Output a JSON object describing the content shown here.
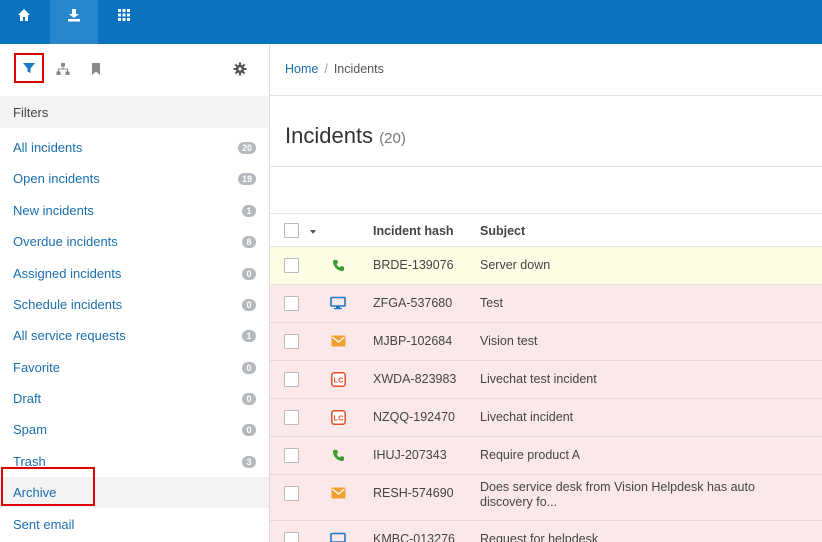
{
  "topbar": {
    "buttons": [
      {
        "name": "home",
        "icon": "home-icon"
      },
      {
        "name": "download",
        "icon": "download-icon",
        "active": true
      },
      {
        "name": "apps",
        "icon": "grid-icon"
      }
    ]
  },
  "sidebar": {
    "tools": [
      "filter-icon",
      "hierarchy-icon",
      "bookmark-icon",
      "gear-icon"
    ],
    "filters_heading": "Filters",
    "items": [
      {
        "label": "All incidents",
        "count": "20"
      },
      {
        "label": "Open incidents",
        "count": "19"
      },
      {
        "label": "New incidents",
        "count": "1"
      },
      {
        "label": "Overdue incidents",
        "count": "8"
      },
      {
        "label": "Assigned incidents",
        "count": "0"
      },
      {
        "label": "Schedule incidents",
        "count": "0"
      },
      {
        "label": "All service requests",
        "count": "1"
      },
      {
        "label": "Favorite",
        "count": "0"
      },
      {
        "label": "Draft",
        "count": "0"
      },
      {
        "label": "Spam",
        "count": "0"
      },
      {
        "label": "Trash",
        "count": "3"
      },
      {
        "label": "Archive",
        "count": ""
      },
      {
        "label": "Sent email",
        "count": ""
      }
    ]
  },
  "breadcrumb": {
    "home": "Home",
    "separator": "/",
    "current": "Incidents"
  },
  "page": {
    "title": "Incidents",
    "count": "(20)"
  },
  "table": {
    "columns": {
      "hash": "Incident hash",
      "subject": "Subject"
    },
    "rows": [
      {
        "icon": "phone-icon",
        "hash": "BRDE-139076",
        "subject": "Server down",
        "tint": "yellow"
      },
      {
        "icon": "monitor-icon",
        "hash": "ZFGA-537680",
        "subject": "Test",
        "tint": "pink"
      },
      {
        "icon": "email-icon",
        "hash": "MJBP-102684",
        "subject": "Vision test",
        "tint": "pink"
      },
      {
        "icon": "livechat-icon",
        "hash": "XWDA-823983",
        "subject": "Livechat test incident",
        "tint": "pink"
      },
      {
        "icon": "livechat-icon",
        "hash": "NZQQ-192470",
        "subject": "Livechat incident",
        "tint": "pink"
      },
      {
        "icon": "phone-icon",
        "hash": "IHUJ-207343",
        "subject": "Require product A",
        "tint": "pink"
      },
      {
        "icon": "email-icon",
        "hash": "RESH-574690",
        "subject": "Does service desk from Vision Helpdesk has auto discovery fo...",
        "tint": "pink"
      },
      {
        "icon": "monitor-icon",
        "hash": "KMBC-013276",
        "subject": "Request for helpdesk",
        "tint": "pink"
      }
    ],
    "livechat_icon_text": "LC"
  },
  "colors": {
    "topbar": "#0b72bf",
    "link": "#1a6faf",
    "highlight": "#e00000"
  }
}
